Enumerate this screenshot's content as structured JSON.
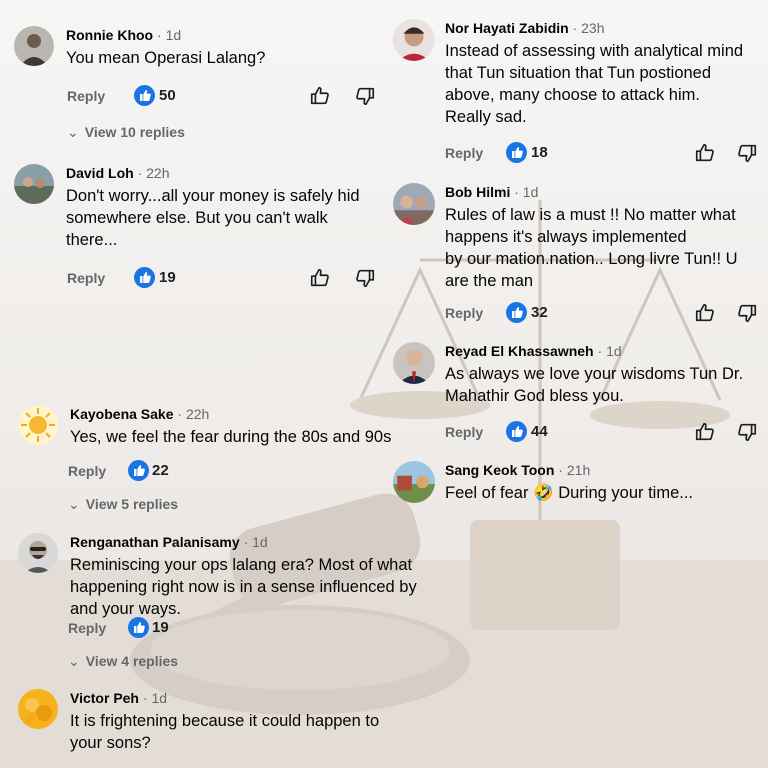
{
  "comments": [
    {
      "name": "Ronnie Khoo",
      "time": "1d",
      "lines": [
        "You mean Operasi Lalang?"
      ],
      "reply": "Reply",
      "likes": "50",
      "view_replies": "View 10 replies"
    },
    {
      "name": "David Loh",
      "time": "22h",
      "lines": [
        "Don't worry...all your money is safely hid",
        "somewhere else. But you can't walk",
        "there..."
      ],
      "reply": "Reply",
      "likes": "19"
    },
    {
      "name": "Kayobena Sake",
      "time": "22h",
      "lines": [
        "Yes, we feel the fear during the 80s and 90s"
      ],
      "reply": "Reply",
      "likes": "22",
      "view_replies": "View 5 replies"
    },
    {
      "name": "Renganathan Palanisamy",
      "time": "1d",
      "lines": [
        "Reminiscing your ops lalang era? Most of what",
        "happening right now is in a sense influenced by",
        "and your ways."
      ],
      "reply": "Reply",
      "likes": "19",
      "view_replies": "View 4 replies"
    },
    {
      "name": "Victor Peh",
      "time": "1d",
      "lines": [
        "It is frightening because it could happen to",
        "your sons?"
      ]
    },
    {
      "name": "Nor Hayati Zabidin",
      "time": "23h",
      "lines": [
        "Instead of assessing with analytical mind",
        "that Tun situation that Tun postioned",
        "above, many choose to attack him.",
        "Really sad."
      ],
      "reply": "Reply",
      "likes": "18"
    },
    {
      "name": "Bob Hilmi",
      "time": "1d",
      "lines": [
        "Rules of law is a must !! No matter what",
        "happens it's always implemented",
        "by our mation.nation.. Long livre Tun!! U",
        "are the man"
      ],
      "reply": "Reply",
      "likes": "32"
    },
    {
      "name": "Reyad El Khassawneh",
      "time": "1d",
      "lines": [
        "As always we love your wisdoms Tun Dr.",
        "Mahathir God bless you."
      ],
      "reply": "Reply",
      "likes": "44"
    },
    {
      "name": "Sang Keok Toon",
      "time": "21h",
      "lines": [
        "Feel of fear",
        "During your time..."
      ],
      "emoji": "🤣"
    }
  ],
  "colors": {
    "accent": "#1b74e4",
    "muted": "#65676b",
    "text": "#050505"
  },
  "icons": {
    "like_badge": "like-thumb-badge-icon",
    "like": "thumbs-up-icon",
    "dislike": "thumbs-down-icon",
    "chevron": "chevron-down-icon"
  }
}
